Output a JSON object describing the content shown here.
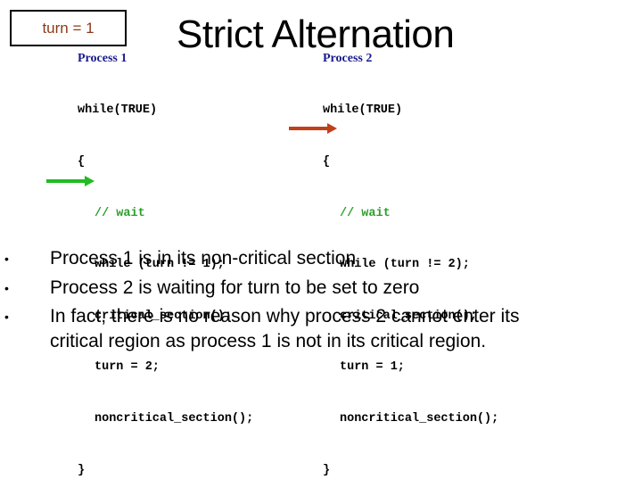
{
  "turn_box": {
    "label": "turn = 1"
  },
  "title": "Strict Alternation",
  "process1": {
    "label": "Process 1",
    "code": [
      {
        "text": "while(TRUE)",
        "type": "code",
        "indent": 0
      },
      {
        "text": "{",
        "type": "code",
        "indent": 0
      },
      {
        "text": "// wait",
        "type": "comment",
        "indent": 1
      },
      {
        "text": "while (turn != 1);",
        "type": "code",
        "indent": 1
      },
      {
        "text": "critical_section();",
        "type": "code",
        "indent": 1
      },
      {
        "text": "turn = 2;",
        "type": "code",
        "indent": 1
      },
      {
        "text": "noncritical_section();",
        "type": "code",
        "indent": 1
      },
      {
        "text": "}",
        "type": "code",
        "indent": 0
      }
    ],
    "arrow_line": "noncritical_section();",
    "arrow_color": "#22bb22"
  },
  "process2": {
    "label": "Process 2",
    "code": [
      {
        "text": "while(TRUE)",
        "type": "code",
        "indent": 0
      },
      {
        "text": "{",
        "type": "code",
        "indent": 0
      },
      {
        "text": "// wait",
        "type": "comment",
        "indent": 1
      },
      {
        "text": "while (turn != 2);",
        "type": "code",
        "indent": 1
      },
      {
        "text": "critical_section();",
        "type": "code",
        "indent": 1
      },
      {
        "text": "turn = 1;",
        "type": "code",
        "indent": 1
      },
      {
        "text": "noncritical_section();",
        "type": "code",
        "indent": 1
      },
      {
        "text": "}",
        "type": "code",
        "indent": 0
      }
    ],
    "arrow_line": "while (turn != 2);",
    "arrow_color": "#c0401a"
  },
  "bullets": [
    {
      "bullet": "•",
      "lines": [
        "Process 1 is in its non-critical section"
      ]
    },
    {
      "bullet": "•",
      "lines": [
        "Process 2 is waiting for turn to be set to zero"
      ]
    },
    {
      "bullet": "•",
      "lines": [
        "In fact, there is no reason why process 2 cannot enter its",
        "critical region as process 1 is not in its critical region."
      ]
    }
  ]
}
